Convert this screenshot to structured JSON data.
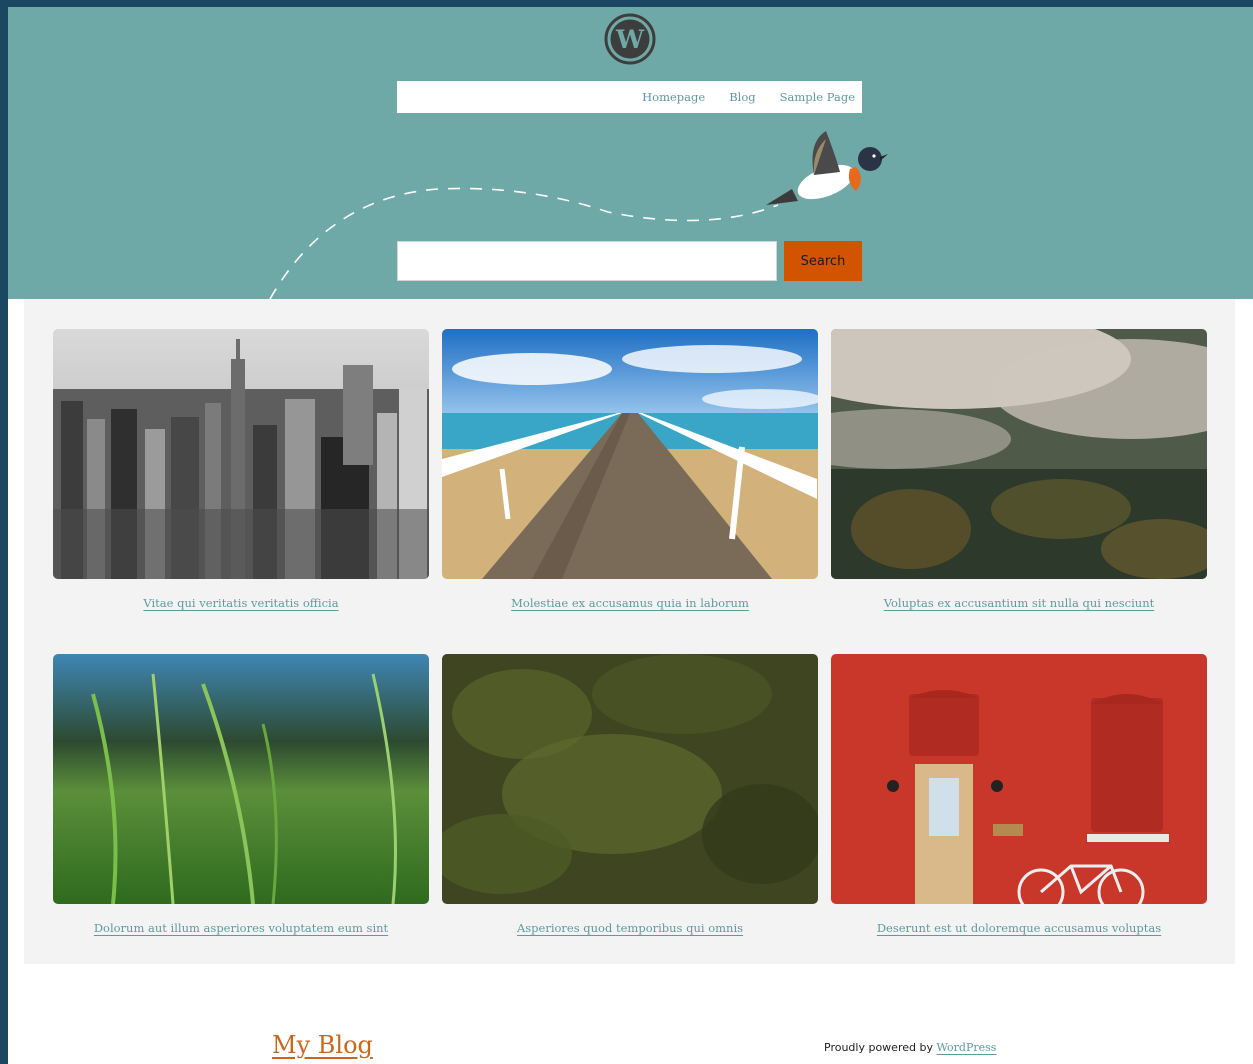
{
  "header": {
    "logo_icon": "wordpress-logo-icon",
    "nav": [
      "Homepage",
      "Blog",
      "Sample Page"
    ],
    "search_button_label": "Search",
    "search_placeholder": "",
    "background_color": "#6ea9a8",
    "accent_color": "#d35400"
  },
  "posts": [
    {
      "title": "Vitae qui veritatis veritatis officia",
      "image": "city-skyline-image"
    },
    {
      "title": "Molestiae ex accusamus quia in laborum",
      "image": "pier-beach-image"
    },
    {
      "title": "Voluptas ex accusantium sit nulla qui nesciunt",
      "image": "misty-forest-image"
    },
    {
      "title": "Dolorum aut illum asperiores voluptatem eum sint",
      "image": "grass-field-image"
    },
    {
      "title": "Asperiores quod temporibus qui omnis",
      "image": "moss-texture-image"
    },
    {
      "title": "Deserunt est ut doloremque accusamus voluptas",
      "image": "red-brick-door-image"
    }
  ],
  "footer": {
    "site_title": "My Blog",
    "powered_prefix": "Proudly powered by",
    "powered_link": "WordPress"
  }
}
